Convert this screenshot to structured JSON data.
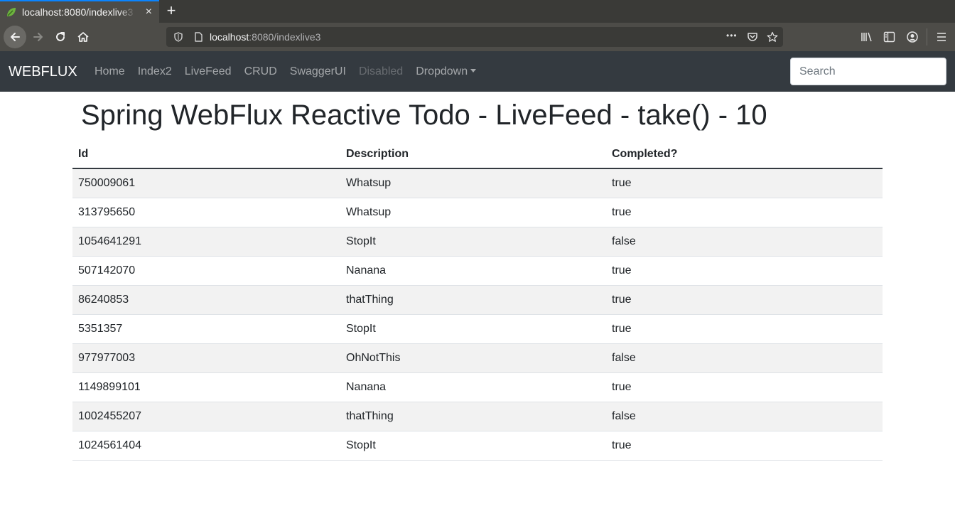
{
  "browser": {
    "tab_title": "localhost:8080/indexlive3",
    "tab_close": "×",
    "new_tab": "+",
    "url_host": "localhost",
    "url_rest": ":8080/indexlive3",
    "url_more": "•••"
  },
  "navbar": {
    "brand": "WEBFLUX",
    "links": [
      "Home",
      "Index2",
      "LiveFeed",
      "CRUD",
      "SwaggerUI",
      "Disabled",
      "Dropdown"
    ],
    "search_placeholder": "Search"
  },
  "page": {
    "title": "Spring WebFlux Reactive Todo - LiveFeed - take() - 10"
  },
  "table": {
    "headers": [
      "Id",
      "Description",
      "Completed?"
    ],
    "rows": [
      [
        "750009061",
        "Whatsup",
        "true"
      ],
      [
        "313795650",
        "Whatsup",
        "true"
      ],
      [
        "1054641291",
        "StopIt",
        "false"
      ],
      [
        "507142070",
        "Nanana",
        "true"
      ],
      [
        "86240853",
        "thatThing",
        "true"
      ],
      [
        "5351357",
        "StopIt",
        "true"
      ],
      [
        "977977003",
        "OhNotThis",
        "false"
      ],
      [
        "1149899101",
        "Nanana",
        "true"
      ],
      [
        "1002455207",
        "thatThing",
        "false"
      ],
      [
        "1024561404",
        "StopIt",
        "true"
      ]
    ]
  },
  "colors": {
    "navbar_bg": "#343a40",
    "tab_accent": "#0a84ff",
    "favicon_green": "#6db33f"
  }
}
